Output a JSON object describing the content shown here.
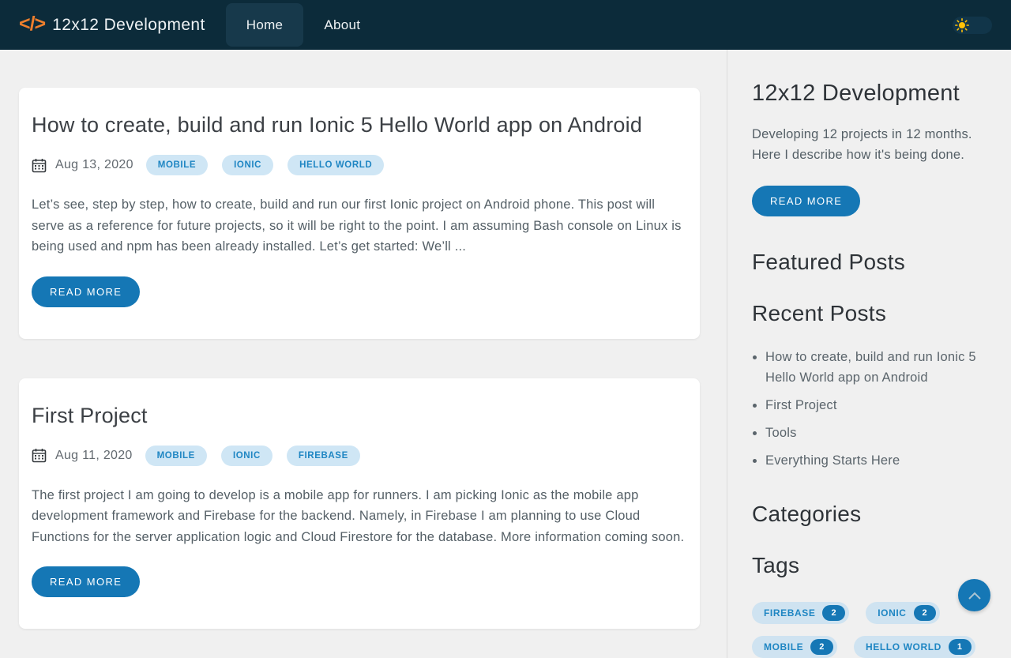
{
  "navbar": {
    "brand": "12x12 Development",
    "links": [
      {
        "label": "Home"
      },
      {
        "label": "About"
      }
    ]
  },
  "posts": [
    {
      "title": "How to create, build and run Ionic 5 Hello World app on Android",
      "date": "Aug 13, 2020",
      "tags": [
        "MOBILE",
        "IONIC",
        "HELLO WORLD"
      ],
      "excerpt": "Let’s see, step by step, how to create, build and run our first Ionic project on Android phone. This post will serve as a reference for future projects, so it will be right to the point. I am assuming Bash console on Linux is being used and npm has been already installed. Let’s get started: We’ll ...",
      "read_more": "READ MORE"
    },
    {
      "title": "First Project",
      "date": "Aug 11, 2020",
      "tags": [
        "MOBILE",
        "IONIC",
        "FIREBASE"
      ],
      "excerpt": "The first project I am going to develop is a mobile app for runners. I am picking Ionic as the mobile app development framework and Firebase for the backend. Namely, in Firebase I am planning to use Cloud Functions for the server application logic and Cloud Firestore for the database. More information coming soon.",
      "read_more": "READ MORE"
    }
  ],
  "sidebar": {
    "title": "12x12 Development",
    "description": "Developing 12 projects in 12 months. Here I describe how it's being done.",
    "read_more": "READ MORE",
    "featured_heading": "Featured Posts",
    "recent_heading": "Recent Posts",
    "recent_posts": [
      "How to create, build and run Ionic 5 Hello World app on Android",
      "First Project",
      "Tools",
      "Everything Starts Here"
    ],
    "categories_heading": "Categories",
    "tags_heading": "Tags",
    "tags": [
      {
        "label": "FIREBASE",
        "count": "2"
      },
      {
        "label": "IONIC",
        "count": "2"
      },
      {
        "label": "MOBILE",
        "count": "2"
      },
      {
        "label": "HELLO WORLD",
        "count": "1"
      }
    ]
  },
  "colors": {
    "navbar_bg": "#0c2b3a",
    "nav_active_bg": "#17394b",
    "logo_orange": "#ee7f2d",
    "accent_blue": "#1577b5",
    "tag_bg": "#cfe6f5",
    "tag_text": "#1f86c3",
    "page_bg": "#f0f0f0",
    "sun_yellow": "#ffc107"
  }
}
